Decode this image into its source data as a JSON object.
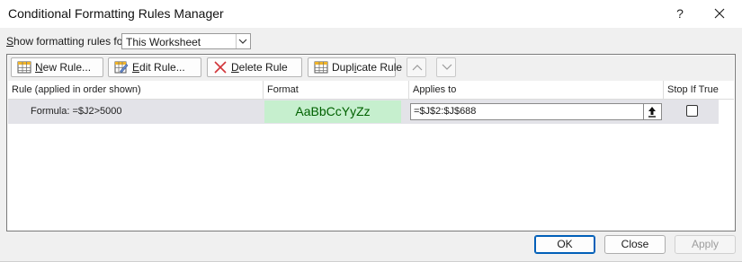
{
  "window": {
    "title": "Conditional Formatting Rules Manager",
    "help_glyph": "?"
  },
  "show_rules": {
    "label_prefix": "",
    "label_hotkey": "S",
    "label_rest": "how formatting rules for:",
    "selected": "This Worksheet"
  },
  "toolbar": {
    "new_rule": {
      "hotkey": "N",
      "rest": "ew Rule..."
    },
    "edit_rule": {
      "hotkey": "E",
      "rest": "dit Rule..."
    },
    "delete_rule": {
      "hotkey": "D",
      "rest": "elete Rule"
    },
    "duplicate_rule": {
      "pre": "Dupl",
      "hotkey": "i",
      "rest": "cate Rule"
    },
    "move_up_icon": "chevron-up-icon",
    "move_down_icon": "chevron-down-icon"
  },
  "columns": {
    "rule": "Rule (applied in order shown)",
    "format": "Format",
    "applies_to": "Applies to",
    "stop_if_true": "Stop If True"
  },
  "rules": [
    {
      "rule": "Formula: =$J2>5000",
      "format_preview": "AaBbCcYyZz",
      "format_fill": "#c6efce",
      "format_font_color": "#006100",
      "applies_to": "=$J$2:$J$688",
      "stop_if_true": false
    }
  ],
  "footer": {
    "ok": "OK",
    "close": "Close",
    "apply": "Apply"
  },
  "colors": {
    "accent": "#005fb8",
    "selected_row": "#e3e3e8",
    "delete_x": "#d13438"
  }
}
